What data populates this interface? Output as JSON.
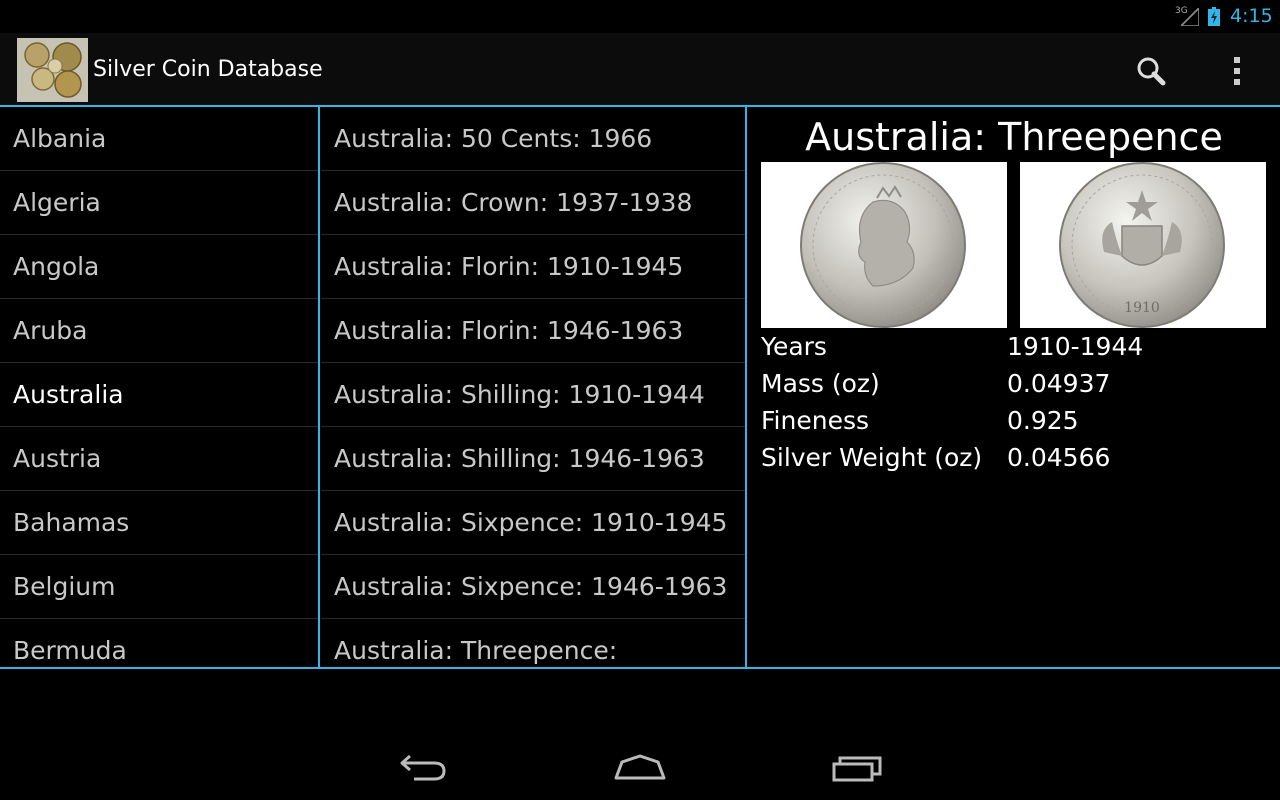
{
  "status": {
    "network": "3G",
    "time": "4:15"
  },
  "app": {
    "title": "Silver Coin Database"
  },
  "icons": {
    "app": "coins-app-icon",
    "search": "search-icon",
    "overflow": "overflow-menu-icon",
    "back": "back-icon",
    "home": "home-icon",
    "recents": "recents-icon"
  },
  "colors": {
    "accent": "#33b5e5",
    "background": "#000000",
    "text": "#ffffff"
  },
  "countries": {
    "selected": "Australia",
    "items": [
      "Albania",
      "Algeria",
      "Angola",
      "Aruba",
      "Australia",
      "Austria",
      "Bahamas",
      "Belgium",
      "Bermuda"
    ]
  },
  "coins": {
    "items": [
      "Australia: 50 Cents: 1966",
      "Australia: Crown: 1937-1938",
      "Australia: Florin: 1910-1945",
      "Australia: Florin: 1946-1963",
      "Australia: Shilling: 1910-1944",
      "Australia: Shilling: 1946-1963",
      "Australia: Sixpence: 1910-1945",
      "Australia: Sixpence: 1946-1963",
      "Australia: Threepence:"
    ]
  },
  "detail": {
    "title": "Australia: Threepence",
    "reverse_year": "1910",
    "specs": [
      {
        "label": "Years",
        "value": "1910-1944"
      },
      {
        "label": "Mass (oz)",
        "value": "0.04937"
      },
      {
        "label": "Fineness",
        "value": "0.925"
      },
      {
        "label": "Silver Weight (oz)",
        "value": "0.04566"
      }
    ]
  }
}
